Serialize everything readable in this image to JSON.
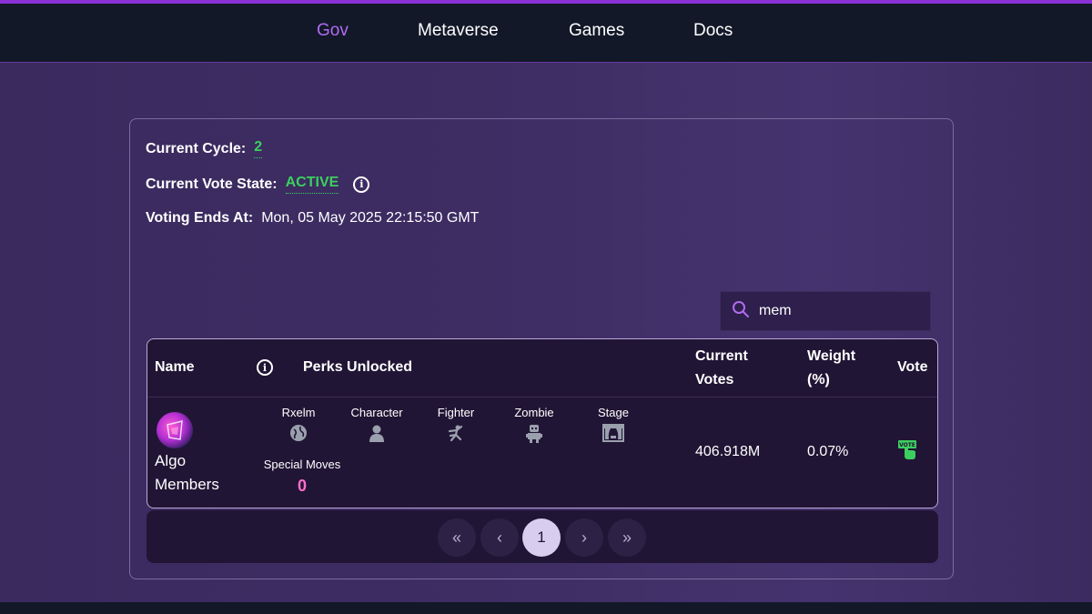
{
  "nav": {
    "items": [
      {
        "label": "Gov",
        "active": true
      },
      {
        "label": "Metaverse"
      },
      {
        "label": "Games"
      },
      {
        "label": "Docs"
      }
    ]
  },
  "status": {
    "cycle_label": "Current Cycle:",
    "cycle_value": "2",
    "state_label": "Current Vote State:",
    "state_value": "ACTIVE",
    "ends_label": "Voting Ends At:",
    "ends_value": "Mon, 05 May 2025 22:15:50 GMT"
  },
  "search": {
    "value": "mem"
  },
  "table": {
    "headers": {
      "name": "Name",
      "perks": "Perks Unlocked",
      "votes_line1": "Current",
      "votes_line2": "Votes",
      "weight_line1": "Weight",
      "weight_line2": "(%)",
      "vote": "Vote"
    },
    "rows": [
      {
        "name_line1": "Algo",
        "name_line2": "Members",
        "perks": [
          {
            "label": "Rxelm",
            "icon": "globe-icon"
          },
          {
            "label": "Character",
            "icon": "person-icon"
          },
          {
            "label": "Fighter",
            "icon": "fighter-icon"
          },
          {
            "label": "Zombie",
            "icon": "zombie-icon"
          },
          {
            "label": "Stage",
            "icon": "stage-icon"
          }
        ],
        "special_moves_label": "Special Moves",
        "special_moves_value": "0",
        "current_votes": "406.918M",
        "weight": "0.07%",
        "vote_icon_text": "VOTE"
      }
    ]
  },
  "pagination": {
    "first": "«",
    "prev": "‹",
    "current": "1",
    "next": "›",
    "last": "»"
  },
  "colors": {
    "accent": "#b06cf0",
    "active_green": "#3ccf5f",
    "special_moves": "#ff6fcf"
  }
}
